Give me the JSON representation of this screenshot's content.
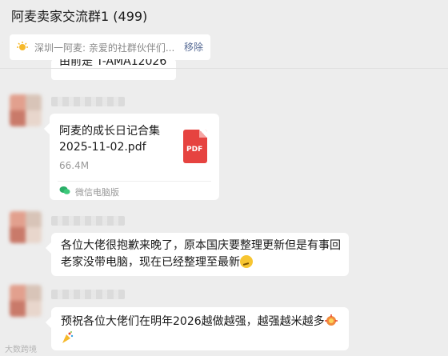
{
  "header": {
    "title": "阿麦卖家交流群1 (499)"
  },
  "pinned": {
    "text": "深圳一阿麦: 亲爱的社群伙伴们...",
    "remove_label": "移除"
  },
  "partial_message": {
    "text": "由前是 T-AMA12026"
  },
  "file_message": {
    "file_name": "阿麦的成长日记合集2025-11-02.pdf",
    "file_size": "66.4M",
    "file_type_label": "PDF",
    "source_label": "微信电脑版"
  },
  "messages": [
    {
      "text": "各位大佬很抱歉来晚了，原本国庆要整理更新但是有事回老家没带电脑，现在已经整理至最新"
    },
    {
      "text": "预祝各位大佬们在明年2026越做越强，越强越米越多"
    }
  ],
  "watermark": {
    "text": "大数跨境"
  },
  "colors": {
    "background": "#ededed",
    "bubble": "#ffffff",
    "link": "#576b95",
    "pdf_red": "#e64340"
  }
}
